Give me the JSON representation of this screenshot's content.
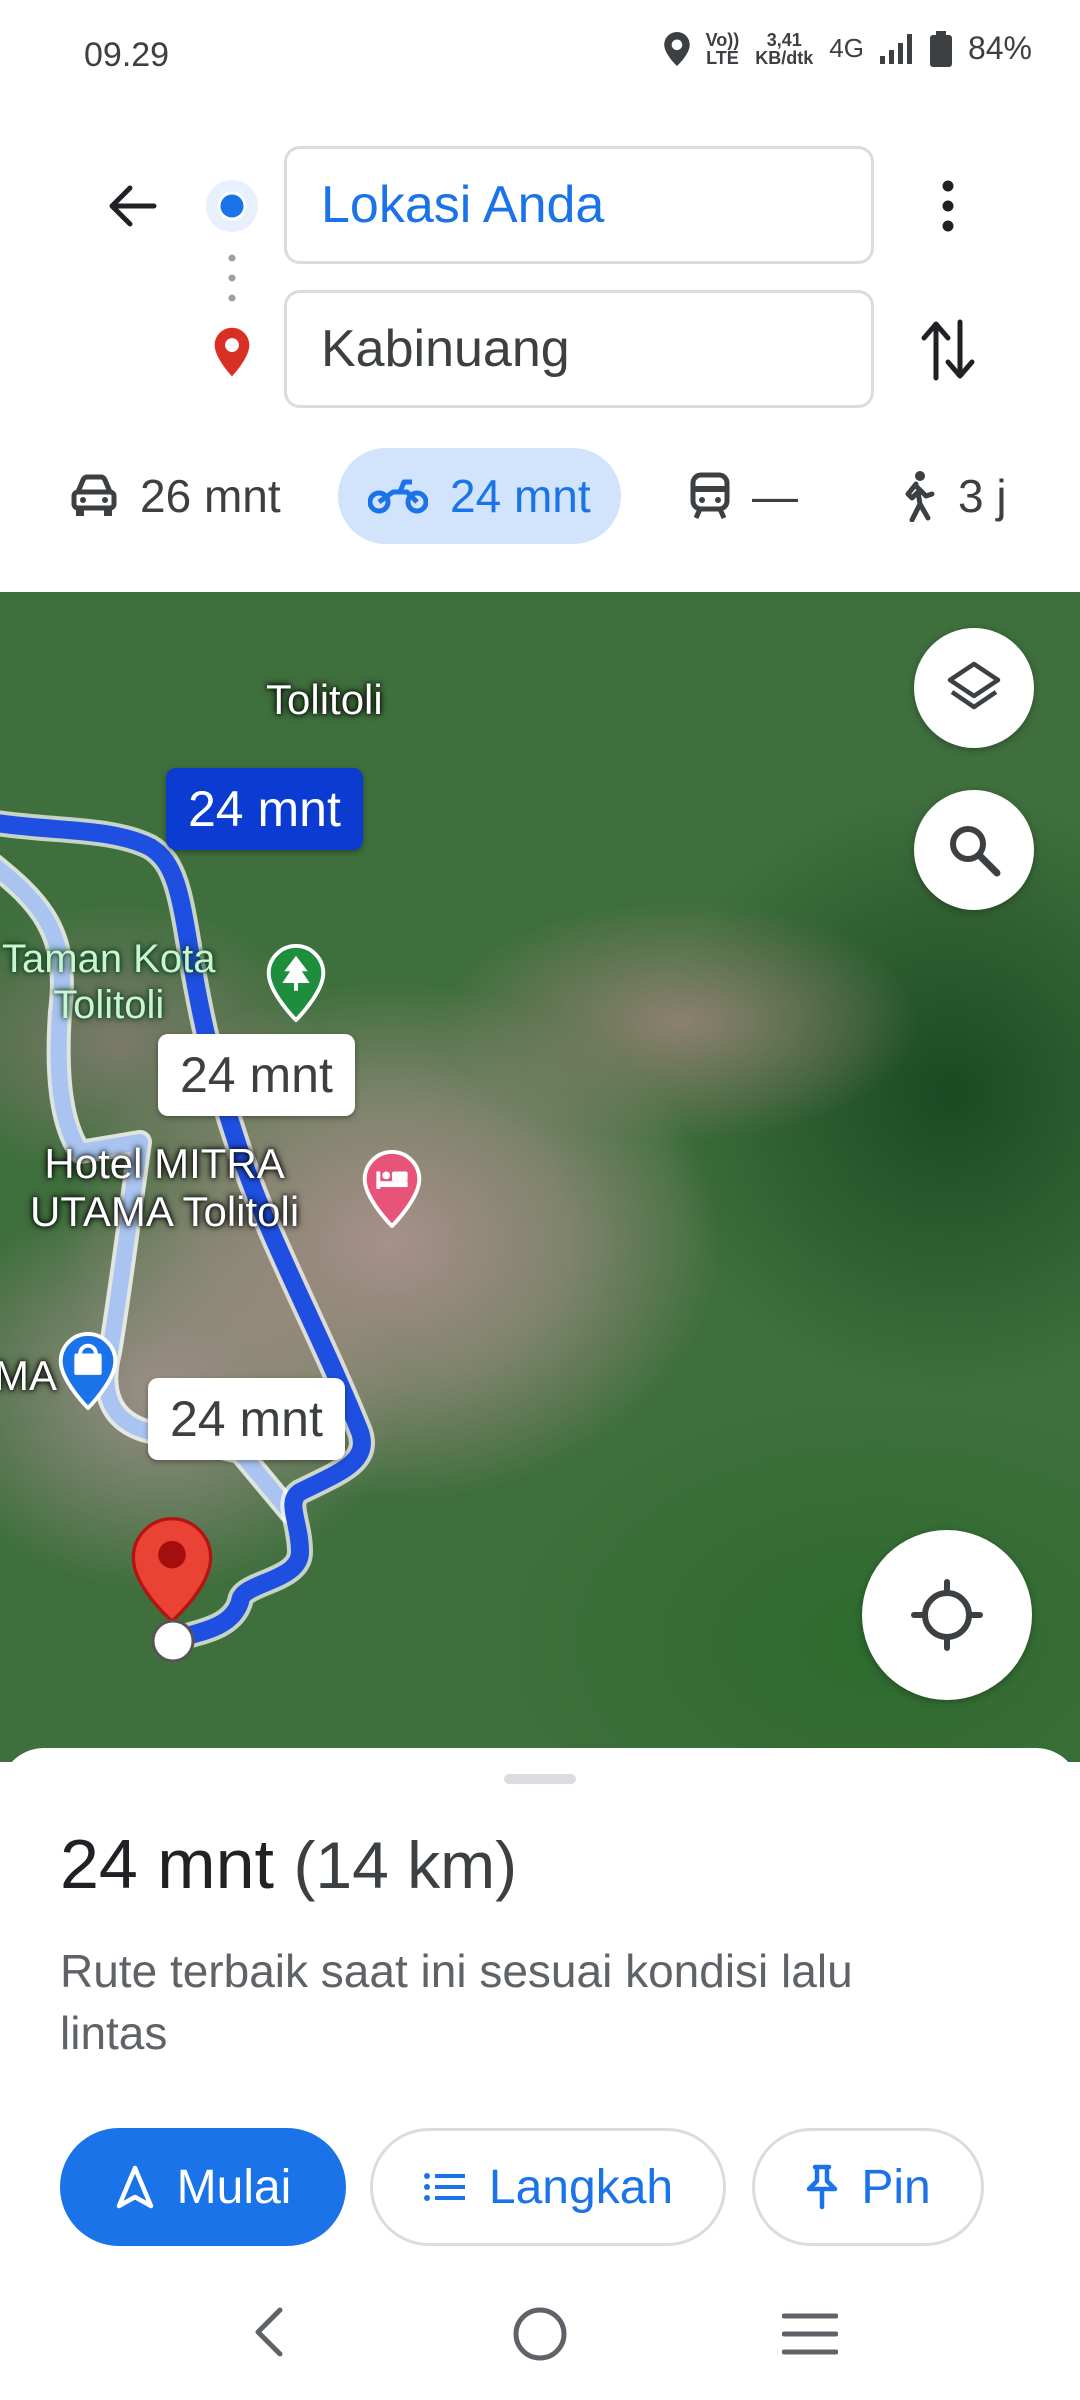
{
  "status_bar": {
    "time": "09.29",
    "network_top": "Vo))",
    "network_bottom": "LTE",
    "speed_top": "3,41",
    "speed_bottom": "KB/dtk",
    "signal": "4G",
    "battery": "84%"
  },
  "header": {
    "origin": "Lokasi Anda",
    "destination": "Kabinuang"
  },
  "modes": {
    "car": "26 mnt",
    "motorcycle": "24 mnt",
    "transit": "—",
    "walk": "3 j"
  },
  "map": {
    "labels": {
      "town": "Tolitoli",
      "park": "Taman Kota\nTolitoli",
      "hotel": "Hotel MITRA\nUTAMA Tolitoli",
      "partial": "MA"
    },
    "route_bubbles": {
      "selected": "24 mnt",
      "alt1": "24 mnt",
      "alt2": "24 mnt"
    }
  },
  "sheet": {
    "duration": "24 mnt",
    "distance": "(14 km)",
    "description": "Rute terbaik saat ini sesuai kondisi lalu lintas",
    "buttons": {
      "start": "Mulai",
      "steps": "Langkah",
      "pin": "Pin"
    }
  },
  "colors": {
    "accent": "#1a73e8",
    "route_selected": "#1f4fe0",
    "route_alt": "#a9c4f0",
    "destination_pin": "#d93025"
  }
}
